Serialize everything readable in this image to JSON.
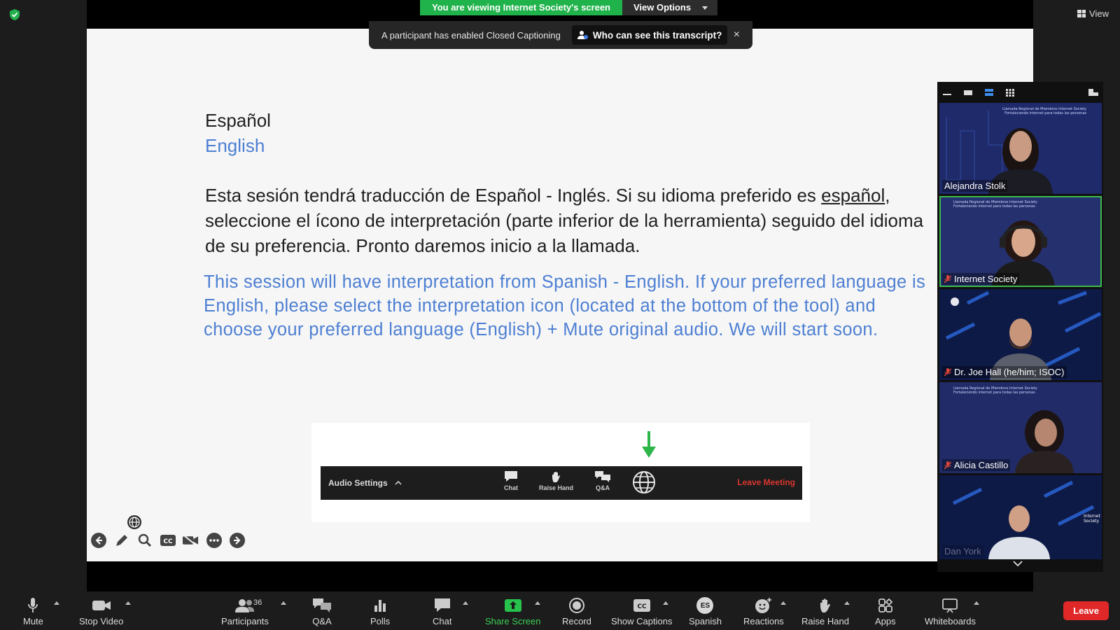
{
  "banner": {
    "sharing_text": "You are viewing Internet Society's screen",
    "view_options": "View Options"
  },
  "top_right": {
    "view_label": "View"
  },
  "cc_notice": {
    "text": "A participant has enabled Closed Captioning",
    "who_label": "Who can see this transcript?",
    "close": "×"
  },
  "slide": {
    "es_title": "Español",
    "en_title": "English",
    "es_body_1": "Esta sesión tendrá traducción de Español - Inglés. Si su idioma preferido es ",
    "es_body_link": "español",
    "es_body_2": ", seleccione el ícono de interpretación (parte inferior de la herramienta) seguido del idioma de su preferencia. Pronto daremos inicio a la llamada.",
    "en_line_1": "This session will have interpretation from Spanish - English. If your preferred language is",
    "en_line_2": "English, please select the interpretation icon (located at the bottom of the tool) and",
    "en_line_3": "choose your preferred language (English) + Mute original audio. We will start soon.",
    "toolbar_image": {
      "audio_settings": "Audio Settings",
      "chat": "Chat",
      "raise_hand": "Raise Hand",
      "qa": "Q&A",
      "leave": "Leave Meeting"
    }
  },
  "gallery": {
    "tiles": [
      {
        "name": "Alejandra Stolk",
        "bg_text": "Llamada Regional de Miembros Internet Society Fortaleciendo internet para todas las personas"
      },
      {
        "name": "Internet Society",
        "bg_text": "Llamada Regional de Miembros Internet Society Fortaleciendo internet para todas las personas"
      },
      {
        "name": "Dr. Joe Hall (he/him; ISOC)",
        "bg_text": ""
      },
      {
        "name": "Alicia Castillo",
        "bg_text": "Llamada Regional de Miembros Internet Society Fortaleciendo internet para todas las personas"
      },
      {
        "name": "Dan York",
        "bg_text": "Internet Society"
      }
    ]
  },
  "toolbar": {
    "mute": "Mute",
    "stop_video": "Stop Video",
    "participants": "Participants",
    "participants_count": "36",
    "qa": "Q&A",
    "polls": "Polls",
    "chat": "Chat",
    "share_screen": "Share Screen",
    "record": "Record",
    "show_captions": "Show Captions",
    "language_badge": "ES",
    "language": "Spanish",
    "reactions": "Reactions",
    "raise_hand": "Raise Hand",
    "apps": "Apps",
    "whiteboards": "Whiteboards",
    "leave": "Leave"
  },
  "colors": {
    "share_green": "#21b34b",
    "slide_blue": "#4d7fd3",
    "leave_red": "#e02828",
    "active_green": "#3dbb4d"
  }
}
